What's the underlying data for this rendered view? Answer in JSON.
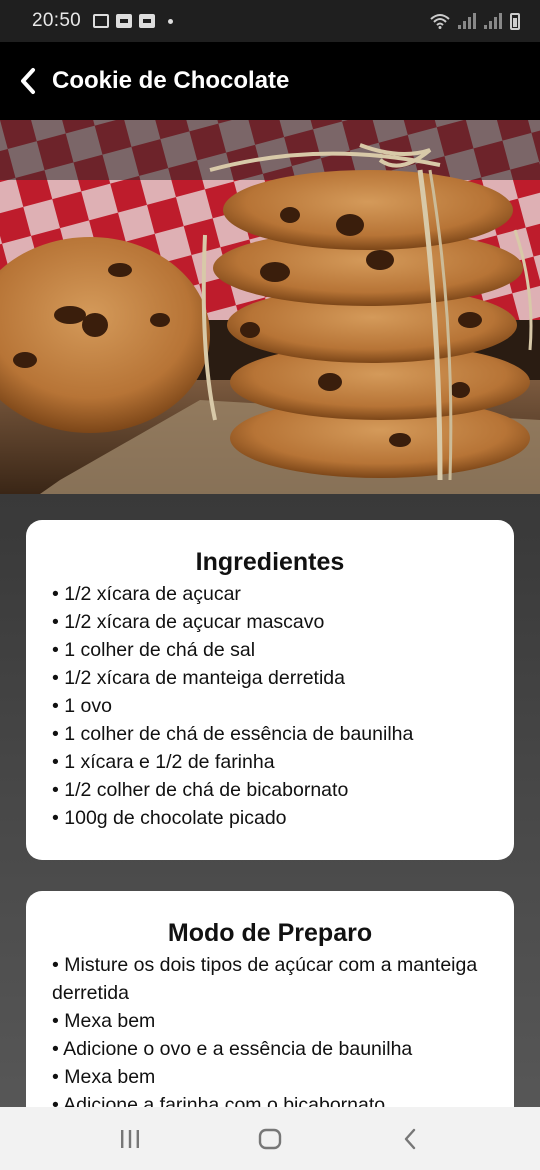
{
  "status_bar": {
    "time": "20:50",
    "icons": [
      "gallery-icon",
      "voicemail-icon",
      "voicemail-icon",
      "dot-icon",
      "wifi-icon",
      "signal-icon",
      "signal-icon",
      "battery-icon"
    ]
  },
  "header": {
    "back_icon": "chevron-left-icon",
    "title": "Cookie de Chocolate"
  },
  "hero_image": {
    "description_icon": "cookie-photo"
  },
  "ingredients": {
    "title": "Ingredientes",
    "items": [
      "1/2 xícara de açucar",
      "1/2 xícara de açucar mascavo",
      "1 colher de chá de sal",
      "1/2 xícara de manteiga derretida",
      "1 ovo",
      "1 colher de chá de essência de baunilha",
      "1 xícara e 1/2 de farinha",
      "1/2 colher de chá de bicabornato",
      "100g de chocolate picado"
    ]
  },
  "preparation": {
    "title": "Modo de Preparo",
    "items": [
      "Misture os dois tipos de açúcar com a manteiga derretida",
      "Mexa bem",
      "Adicione o ovo e a essência de baunilha",
      "Mexa bem",
      "Adicione a farinha com o bicabornato"
    ]
  },
  "nav_bar": {
    "recent_icon": "recent-apps-icon",
    "home_icon": "home-icon",
    "back_icon": "back-icon"
  },
  "colors": {
    "header_bg": "#000000",
    "status_bg": "#1f1f1f",
    "card_bg": "#ffffff",
    "nav_bg": "#f2f2f2"
  }
}
